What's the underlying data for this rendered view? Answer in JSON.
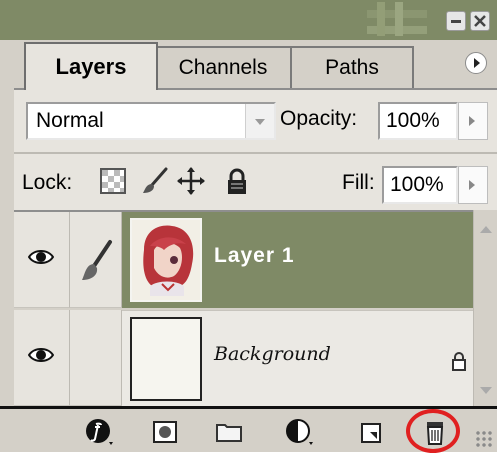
{
  "tabs": [
    {
      "label": "Layers",
      "active": true
    },
    {
      "label": "Channels",
      "active": false
    },
    {
      "label": "Paths",
      "active": false
    }
  ],
  "blend_mode": {
    "value": "Normal"
  },
  "opacity": {
    "label": "Opacity:",
    "value": "100%"
  },
  "lock": {
    "label": "Lock:"
  },
  "fill": {
    "label": "Fill:",
    "value": "100%"
  },
  "layers": [
    {
      "name": "Layer 1",
      "selected": true,
      "visible": true,
      "linked_brush_icon": true
    },
    {
      "name": "Background",
      "selected": false,
      "visible": true,
      "locked": true
    }
  ],
  "bottom_toolbar": [
    "fx-icon",
    "layer-mask-icon",
    "folder-icon",
    "adjustment-layer-icon",
    "new-layer-icon",
    "trash-icon"
  ],
  "colors": {
    "selected_row": "#7f8a66",
    "title_bar": "#7f8a66",
    "highlight_circle": "#e02020"
  }
}
